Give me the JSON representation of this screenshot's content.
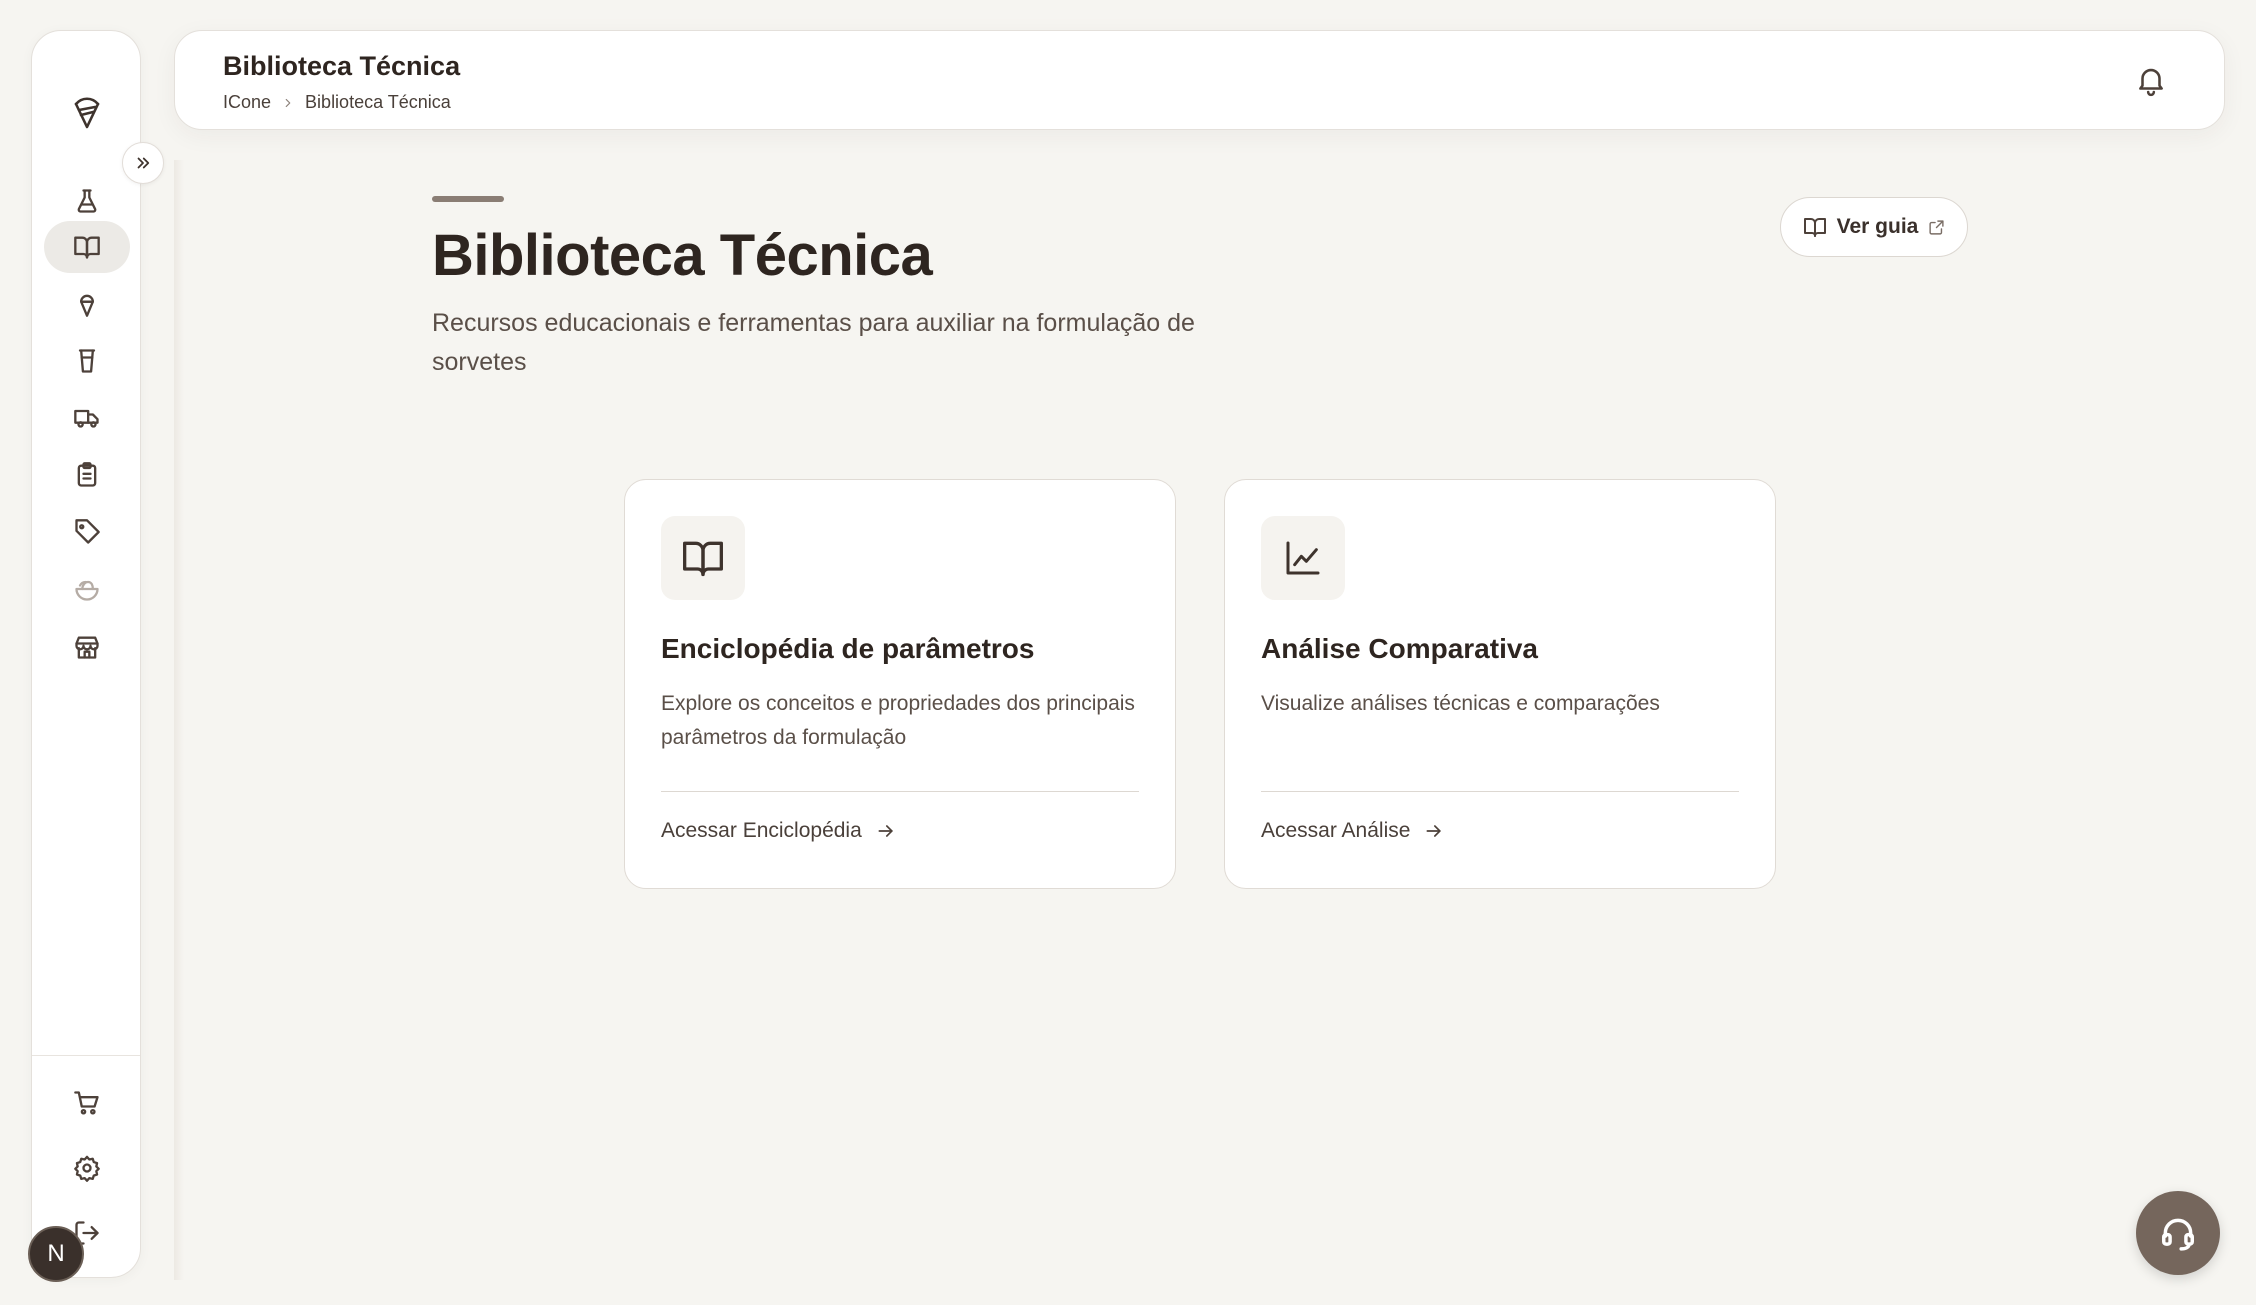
{
  "header": {
    "title": "Biblioteca Técnica",
    "breadcrumb": [
      "ICone",
      "Biblioteca Técnica"
    ]
  },
  "sidebar": {
    "logo_icon": "ice-cream-logo-icon",
    "items": [
      {
        "icon": "flask-icon",
        "active": false
      },
      {
        "icon": "book-open-icon",
        "active": true
      },
      {
        "icon": "ice-cream-cone-icon",
        "active": false
      },
      {
        "icon": "cup-icon",
        "active": false
      },
      {
        "icon": "truck-icon",
        "active": false
      },
      {
        "icon": "clipboard-list-icon",
        "active": false
      },
      {
        "icon": "tag-icon",
        "active": false
      },
      {
        "icon": "bowl-icon",
        "active": false
      },
      {
        "icon": "store-icon",
        "active": false
      }
    ],
    "bottom_items": [
      {
        "icon": "cart-icon"
      },
      {
        "icon": "settings-icon"
      },
      {
        "icon": "logout-icon"
      }
    ],
    "avatar_letter": "N"
  },
  "page": {
    "title": "Biblioteca Técnica",
    "subtitle": "Recursos educacionais e ferramentas para auxiliar na formulação de sorvetes",
    "guide_button": "Ver guia"
  },
  "cards": [
    {
      "icon": "book-open-icon",
      "title": "Enciclopédia de parâmetros",
      "description": "Explore os conceitos e propriedades dos principais parâmetros da formulação",
      "link": "Acessar Enciclopédia"
    },
    {
      "icon": "line-chart-icon",
      "title": "Análise Comparativa",
      "description": "Visualize análises técnicas e comparações",
      "link": "Acessar Análise"
    }
  ],
  "colors": {
    "background": "#f6f5f1",
    "text": "#2e2520",
    "support_button": "#75665c"
  }
}
